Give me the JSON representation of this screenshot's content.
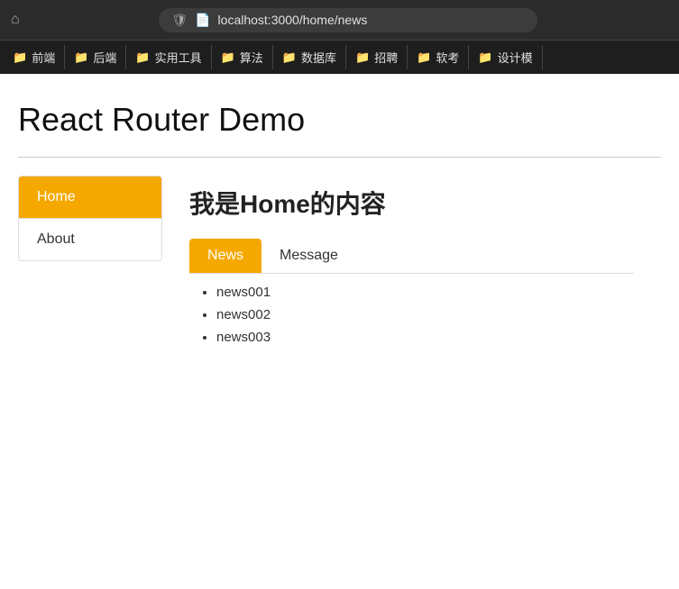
{
  "browser": {
    "url": "localhost:3000/home/news"
  },
  "bookmarks": [
    {
      "label": "前端",
      "icon": "📁"
    },
    {
      "label": "后端",
      "icon": "📁"
    },
    {
      "label": "实用工具",
      "icon": "📁"
    },
    {
      "label": "算法",
      "icon": "📁"
    },
    {
      "label": "数据库",
      "icon": "📁"
    },
    {
      "label": "招聘",
      "icon": "📁"
    },
    {
      "label": "软考",
      "icon": "📁"
    },
    {
      "label": "设计模",
      "icon": "📁"
    }
  ],
  "page": {
    "title": "React Router Demo",
    "home_content_heading": "我是Home的内容"
  },
  "sidebar": {
    "items": [
      {
        "label": "Home",
        "active": true
      },
      {
        "label": "About",
        "active": false
      }
    ]
  },
  "sub_tabs": [
    {
      "label": "News",
      "active": true
    },
    {
      "label": "Message",
      "active": false
    }
  ],
  "news_items": [
    {
      "text": "news001"
    },
    {
      "text": "news002"
    },
    {
      "text": "news003"
    }
  ]
}
